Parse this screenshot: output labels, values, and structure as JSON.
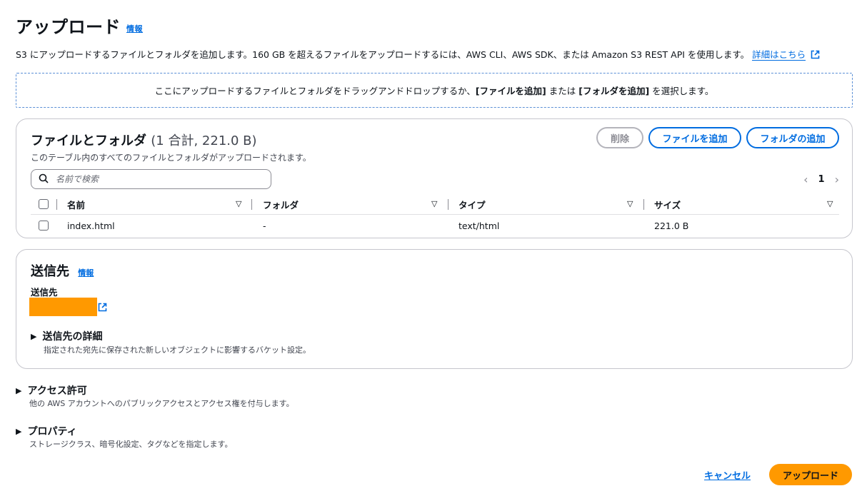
{
  "header": {
    "title": "アップロード",
    "info": "情報",
    "description": "S3 にアップロードするファイルとフォルダを追加します。160 GB を超えるファイルをアップロードするには、AWS CLI、AWS SDK、または Amazon S3 REST API を使用します。",
    "learn_more": "詳細はこちら"
  },
  "dropzone": {
    "text_before": "ここにアップロードするファイルとフォルダをドラッグアンドドロップするか、",
    "add_files": "[ファイルを追加]",
    "middle": " または ",
    "add_folder": "[フォルダを追加]",
    "text_after": " を選択します。"
  },
  "files": {
    "title": "ファイルとフォルダ",
    "count": "(1 合計, 221.0 B)",
    "subtitle": "このテーブル内のすべてのファイルとフォルダがアップロードされます。",
    "delete_label": "削除",
    "add_files_label": "ファイルを追加",
    "add_folder_label": "フォルダの追加",
    "search_placeholder": "名前で検索",
    "page": "1",
    "columns": [
      "名前",
      "フォルダ",
      "タイプ",
      "サイズ"
    ],
    "rows": [
      {
        "name": "index.html",
        "folder": "-",
        "type": "text/html",
        "size": "221.0 B"
      }
    ]
  },
  "destination": {
    "title": "送信先",
    "info": "情報",
    "label": "送信先",
    "details_title": "送信先の詳細",
    "details_desc": "指定された宛先に保存された新しいオブジェクトに影響するバケット設定。"
  },
  "access": {
    "title": "アクセス許可",
    "desc": "他の AWS アカウントへのパブリックアクセスとアクセス権を付与します。"
  },
  "properties": {
    "title": "プロパティ",
    "desc": "ストレージクラス、暗号化設定、タグなどを指定します。"
  },
  "footer": {
    "cancel": "キャンセル",
    "upload": "アップロード"
  },
  "colors": {
    "link": "#006ce0",
    "primary": "#ff9900",
    "border": "#c6c6cd"
  }
}
